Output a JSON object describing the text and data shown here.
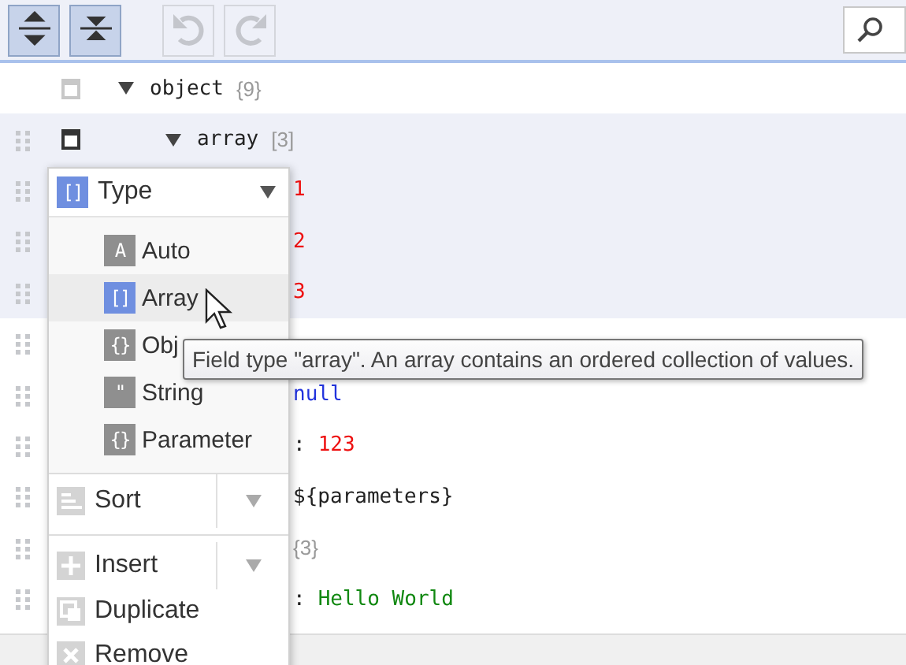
{
  "toolbar": {
    "buttons": [
      {
        "kind": "expand-all",
        "disabled": false
      },
      {
        "kind": "collapse-all",
        "disabled": false
      },
      {
        "kind": "undo",
        "disabled": true
      },
      {
        "kind": "redo",
        "disabled": true
      }
    ]
  },
  "tree": {
    "key": "object",
    "count": "{9}",
    "expanded": true,
    "selected": false,
    "menu_open": false,
    "children": [
      {
        "key": "array",
        "count": "[3]",
        "expanded": true,
        "selected": true,
        "menu_open": true,
        "children": [
          {
            "value": "1",
            "kind": "number",
            "selected": true
          },
          {
            "value": "2",
            "kind": "number",
            "selected": true
          },
          {
            "value": "3",
            "kind": "number",
            "selected": true
          }
        ]
      },
      {
        "selected": false
      },
      {
        "value": "null",
        "kind": "null",
        "selected": false
      },
      {
        "separator": ":",
        "value": "123",
        "kind": "number",
        "selected": false
      },
      {
        "value": "${parameters}",
        "kind": "plain",
        "selected": false
      },
      {
        "count": "{3}",
        "selected": false
      },
      {
        "separator": ":",
        "value": "Hello World",
        "kind": "string",
        "selected": false
      }
    ]
  },
  "context_menu": {
    "type_button": {
      "glyph": "[]",
      "label": "Type"
    },
    "type_items": [
      {
        "glyph": "A",
        "label": "Auto",
        "selected": false
      },
      {
        "glyph": "[]",
        "label": "Array",
        "selected": true
      },
      {
        "glyph": "{}",
        "label": "Obj",
        "selected": false
      },
      {
        "glyph": "\"",
        "label": "String",
        "selected": false
      },
      {
        "glyph": "{}",
        "label": "Parameter",
        "selected": false
      }
    ],
    "actions": [
      {
        "kind": "sort",
        "label": "Sort",
        "split": true
      },
      {
        "kind": "insert",
        "label": "Insert",
        "split": true
      },
      {
        "kind": "duplicate",
        "label": "Duplicate",
        "split": false
      },
      {
        "kind": "remove",
        "label": "Remove",
        "split": false
      }
    ]
  },
  "tooltip": {
    "text": "Field type \"array\". An array contains an ordered collection of values."
  }
}
